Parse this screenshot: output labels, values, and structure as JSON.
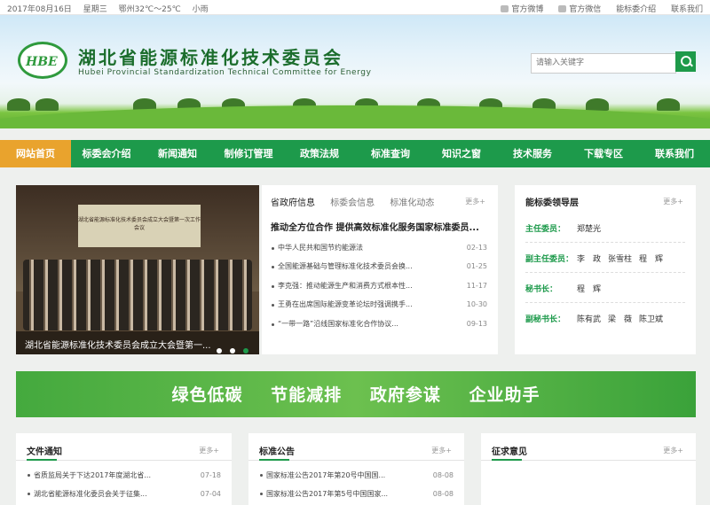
{
  "topbar": {
    "date": "2017年08月16日",
    "weekday": "星期三",
    "weather": "鄂州32℃～25℃",
    "condition": "小雨",
    "links": [
      "官方微博",
      "官方微信",
      "能标委介绍",
      "联系我们"
    ]
  },
  "header": {
    "logo_text": "HBE",
    "title": "湖北省能源标准化技术委员会",
    "subtitle": "Hubei Provincial Standardization Technical Committee for Energy",
    "search_placeholder": "请输入关键字"
  },
  "nav": [
    "网站首页",
    "标委会介绍",
    "新闻通知",
    "制修订管理",
    "政策法规",
    "标准查询",
    "知识之窗",
    "技术服务",
    "下载专区",
    "联系我们"
  ],
  "slider": {
    "board_text": "湖北省能源标准化技术委员会成立大会暨第一次工作会议",
    "caption": "湖北省能源标准化技术委员会成立大会暨第一..."
  },
  "news": {
    "tabs": [
      "省政府信息",
      "标委会信息",
      "标准化动态"
    ],
    "more": "更多+",
    "headline": "推动全方位合作 提供高效标准化服务国家标准委员...",
    "items": [
      {
        "title": "中华人民共和国节约能源法",
        "date": "02-13"
      },
      {
        "title": "全国能源基础与管理标准化技术委员会换...",
        "date": "01-25"
      },
      {
        "title": "李克强：推动能源生产和消费方式根本性...",
        "date": "11-17"
      },
      {
        "title": "王勇在出席国际能源变革论坛时强调携手...",
        "date": "10-30"
      },
      {
        "title": "“一带一路”沿线国家标准化合作协议...",
        "date": "09-13"
      }
    ]
  },
  "leaders": {
    "title": "能标委领导层",
    "more": "更多+",
    "rows": [
      {
        "role": "主任委员：",
        "names": [
          "郑楚光"
        ]
      },
      {
        "role": "副主任委员：",
        "names": [
          "李　政",
          "张雪柱",
          "程　辉"
        ]
      },
      {
        "role": "秘书长：",
        "names": [
          "程　辉"
        ]
      },
      {
        "role": "副秘书长：",
        "names": [
          "陈有武",
          "梁　薇",
          "陈卫斌"
        ]
      }
    ]
  },
  "slogan": [
    "绿色低碳",
    "节能减排",
    "政府参谋",
    "企业助手"
  ],
  "files": {
    "title": "文件通知",
    "more": "更多+",
    "items": [
      {
        "title": "省质监局关于下达2017年度湖北省...",
        "date": "07-18"
      },
      {
        "title": "湖北省能源标准化委员会关于征集...",
        "date": "07-04"
      }
    ]
  },
  "announcements": {
    "title": "标准公告",
    "more": "更多+",
    "items": [
      {
        "title": "国家标准公告2017年第20号中国国...",
        "date": "08-08"
      },
      {
        "title": "国家标准公告2017年第5号中国国家...",
        "date": "08-08"
      }
    ]
  },
  "opinions": {
    "title": "征求意见",
    "more": "更多+"
  },
  "colors": {
    "brand_green": "#1d9a4b",
    "active_nav": "#e9a32d"
  }
}
